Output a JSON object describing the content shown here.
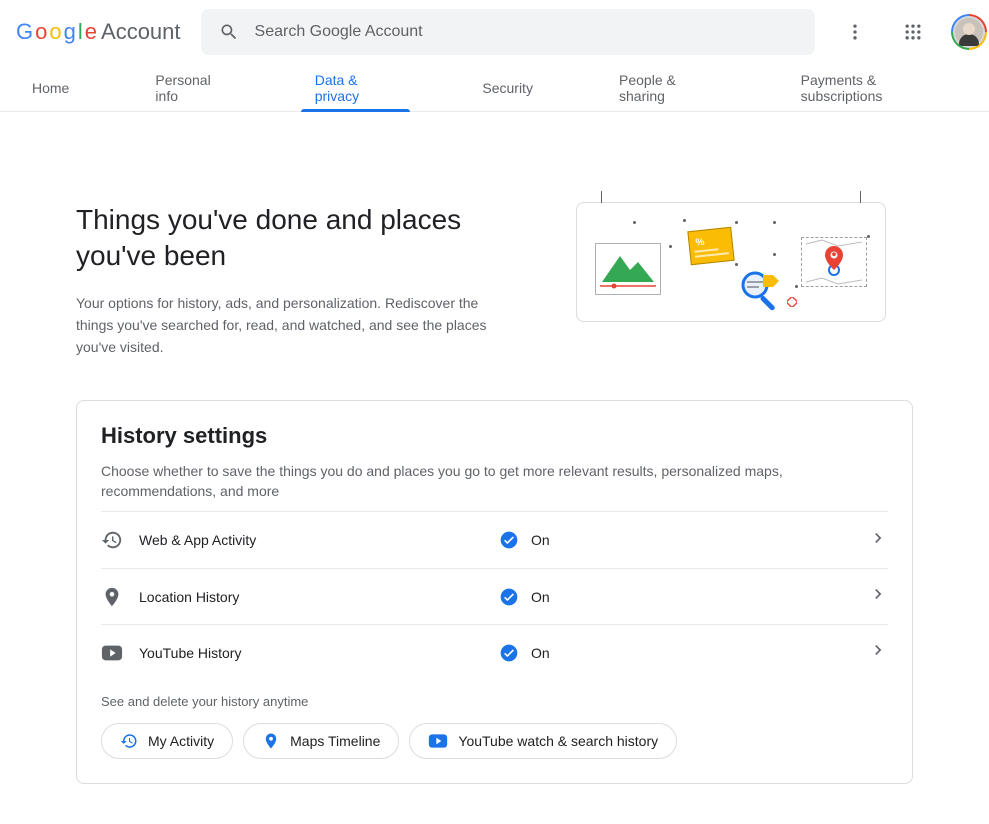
{
  "brand": {
    "product": "Account"
  },
  "search": {
    "placeholder": "Search Google Account"
  },
  "nav": {
    "tabs": [
      "Home",
      "Personal info",
      "Data & privacy",
      "Security",
      "People & sharing",
      "Payments & subscriptions"
    ],
    "active_index": 2
  },
  "page": {
    "title": "Things you've done and places you've been",
    "subtitle": "Your options for history, ads, and personalization. Rediscover the things you've searched for, read, and watched, and see the places you've visited."
  },
  "history_card": {
    "title": "History settings",
    "description": "Choose whether to save the things you do and places you go to get more relevant results, personalized maps, recommendations, and more",
    "rows": [
      {
        "icon": "history",
        "label": "Web & App Activity",
        "status": "On"
      },
      {
        "icon": "pin",
        "label": "Location History",
        "status": "On"
      },
      {
        "icon": "youtube",
        "label": "YouTube History",
        "status": "On"
      }
    ],
    "footnote": "See and delete your history anytime",
    "chips": [
      {
        "icon": "history",
        "label": "My Activity"
      },
      {
        "icon": "pin",
        "label": "Maps Timeline"
      },
      {
        "icon": "youtube",
        "label": "YouTube watch & search history"
      }
    ]
  }
}
